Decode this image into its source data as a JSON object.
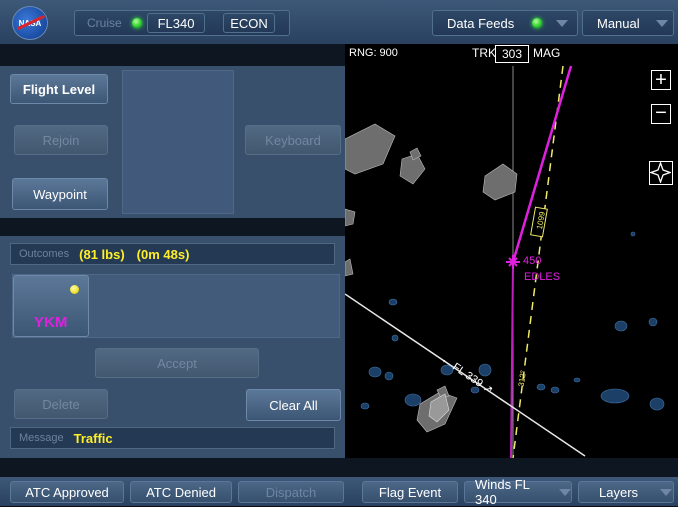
{
  "topbar": {
    "logo_text": "NASA",
    "cruise_label": "Cruise",
    "flight_level": "FL340",
    "mode": "ECON",
    "data_feeds_label": "Data Feeds",
    "status_color": "#2ed12e",
    "manual_label": "Manual"
  },
  "panel": {
    "flight_level_button": "Flight Level",
    "rejoin_button": "Rejoin",
    "keyboard_button": "Keyboard",
    "waypoint_button": "Waypoint",
    "outcomes_label": "Outcomes",
    "outcome_fuel": "(81 lbs)",
    "outcome_time": "(0m 48s)",
    "waypoint_name": "YKM",
    "waypoint_color": "#e020e0",
    "accept_button": "Accept",
    "delete_button": "Delete",
    "clear_all_button": "Clear All",
    "message_label": "Message",
    "message_value": "Traffic"
  },
  "map": {
    "range_label": "RNG: 900",
    "trk_label": "TRK",
    "trk_value": "303",
    "mag_label": "MAG",
    "route_box_label": "1099",
    "fix_alt": "450",
    "fix_name": "EDLES",
    "route_fl_label": "FL 339",
    "heading_label": "312°",
    "zoom_in": "+",
    "zoom_out": "−",
    "center_icon": "compass-star-icon"
  },
  "bottombar": {
    "atc_approved": "ATC Approved",
    "atc_denied": "ATC Denied",
    "dispatch": "Dispatch",
    "flag_event": "Flag Event",
    "winds": "Winds FL 340",
    "layers": "Layers"
  }
}
